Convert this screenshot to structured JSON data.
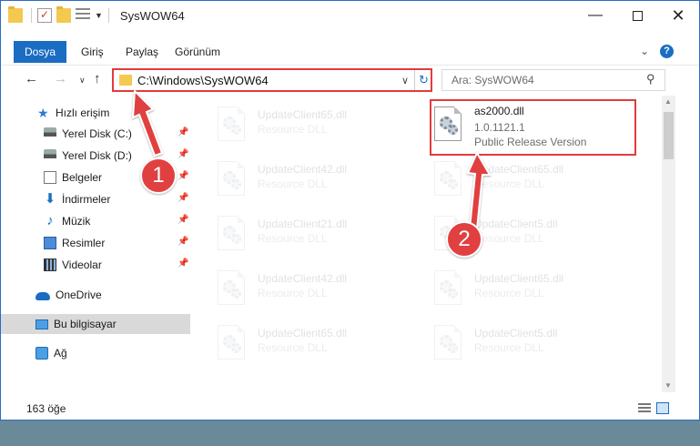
{
  "window": {
    "title": "SysWOW64",
    "minimize": "—",
    "close": "✕"
  },
  "ribbon": {
    "file_tab": "Dosya",
    "tabs": [
      "Giriş",
      "Paylaş",
      "Görünüm"
    ]
  },
  "nav": {
    "address_path": "C:\\Windows\\SysWOW64",
    "search_placeholder": "Ara: SysWOW64"
  },
  "sidebar": {
    "items": [
      {
        "label": "Hızlı erişim",
        "icon": "star-icon"
      },
      {
        "label": "Yerel Disk (C:)",
        "icon": "disk-icon",
        "pinned": true
      },
      {
        "label": "Yerel Disk (D:)",
        "icon": "disk-icon",
        "pinned": true
      },
      {
        "label": "Belgeler",
        "icon": "documents-icon",
        "pinned": true
      },
      {
        "label": "İndirmeler",
        "icon": "download-icon",
        "pinned": true
      },
      {
        "label": "Müzik",
        "icon": "music-icon",
        "pinned": true
      },
      {
        "label": "Resimler",
        "icon": "pictures-icon",
        "pinned": true
      },
      {
        "label": "Videolar",
        "icon": "videos-icon",
        "pinned": true
      },
      {
        "label": "OneDrive",
        "icon": "onedrive-icon"
      },
      {
        "label": "Bu bilgisayar",
        "icon": "this-pc-icon",
        "selected": true
      },
      {
        "label": "Ağ",
        "icon": "network-icon"
      }
    ]
  },
  "files": [
    {
      "name": "UpdateClient65.dll",
      "sub": "Resource DLL"
    },
    {
      "name": "as2000.dll",
      "version": "1.0.1121.1",
      "sub": "Public Release Version"
    },
    {
      "name": "UpdateClient42.dll",
      "sub": "Resource DLL"
    },
    {
      "name": "UpdateClient65.dll",
      "sub": "Resource DLL"
    },
    {
      "name": "UpdateClient21.dll",
      "sub": "Resource DLL"
    },
    {
      "name": "UpdateClient5.dll",
      "sub": "Resource DLL"
    },
    {
      "name": "UpdateClient42.dll",
      "sub": "Resource DLL"
    },
    {
      "name": "UpdateClient65.dll",
      "sub": "Resource DLL"
    },
    {
      "name": "UpdateClient65.dll",
      "sub": "Resource DLL"
    },
    {
      "name": "UpdateClient5.dll",
      "sub": "Resource DLL"
    }
  ],
  "status": {
    "item_count": "163 öğe"
  },
  "callouts": [
    "1",
    "2"
  ],
  "colors": {
    "accent": "#1a6dc2",
    "highlight": "#e23b3b",
    "selection": "#d9d9d9"
  }
}
